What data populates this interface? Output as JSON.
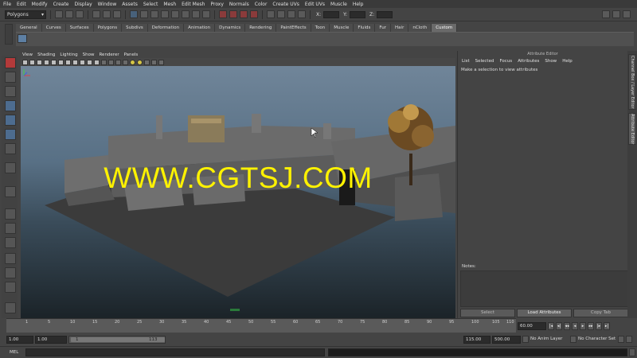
{
  "menubar": {
    "items": [
      "File",
      "Edit",
      "Modify",
      "Create",
      "Display",
      "Window",
      "Assets",
      "Select",
      "Mesh",
      "Edit Mesh",
      "Proxy",
      "Normals",
      "Color",
      "Create UVs",
      "Edit UVs",
      "Muscle",
      "Help"
    ]
  },
  "statusline": {
    "mode": "Polygons",
    "x_label": "X:",
    "y_label": "Y:",
    "z_label": "Z:"
  },
  "shelf": {
    "tabs": [
      "General",
      "Curves",
      "Surfaces",
      "Polygons",
      "Subdivs",
      "Deformation",
      "Animation",
      "Dynamics",
      "Rendering",
      "PaintEffects",
      "Toon",
      "Muscle",
      "Fluids",
      "Fur",
      "Hair",
      "nCloth",
      "Custom"
    ],
    "active_tab": "Custom"
  },
  "viewport": {
    "menu": [
      "View",
      "Shading",
      "Lighting",
      "Show",
      "Renderer",
      "Panels"
    ],
    "watermark": "WWW.CGTSJ.COM"
  },
  "attribute_editor": {
    "title": "Attribute Editor",
    "menu": [
      "List",
      "Selected",
      "Focus",
      "Attributes",
      "Show",
      "Help"
    ],
    "message": "Make a selection to view attributes",
    "notes_label": "Notes:",
    "buttons": {
      "select": "Select",
      "load": "Load Attributes",
      "copy": "Copy Tab"
    }
  },
  "side_tabs": {
    "channel_box": "Channel Box / Layer Editor",
    "attribute_editor": "Attribute Editor"
  },
  "timeslider": {
    "ticks": [
      "1",
      "5",
      "10",
      "15",
      "20",
      "25",
      "30",
      "35",
      "40",
      "45",
      "50",
      "55",
      "60",
      "65",
      "70",
      "75",
      "80",
      "85",
      "90",
      "95",
      "100",
      "105",
      "110"
    ],
    "current_time": "60.00"
  },
  "range": {
    "start": "1.00",
    "start_inner": "1.00",
    "slider_start": "1",
    "slider_end": "113",
    "end_inner": "115.00",
    "end": "500.00",
    "anim_layer": "No Anim Layer",
    "character_set": "No Character Set"
  },
  "commandline": {
    "label": "MEL"
  },
  "colors": {
    "watermark": "#fff200",
    "active_tool": "#b33a3a",
    "ui_bg": "#444444"
  }
}
